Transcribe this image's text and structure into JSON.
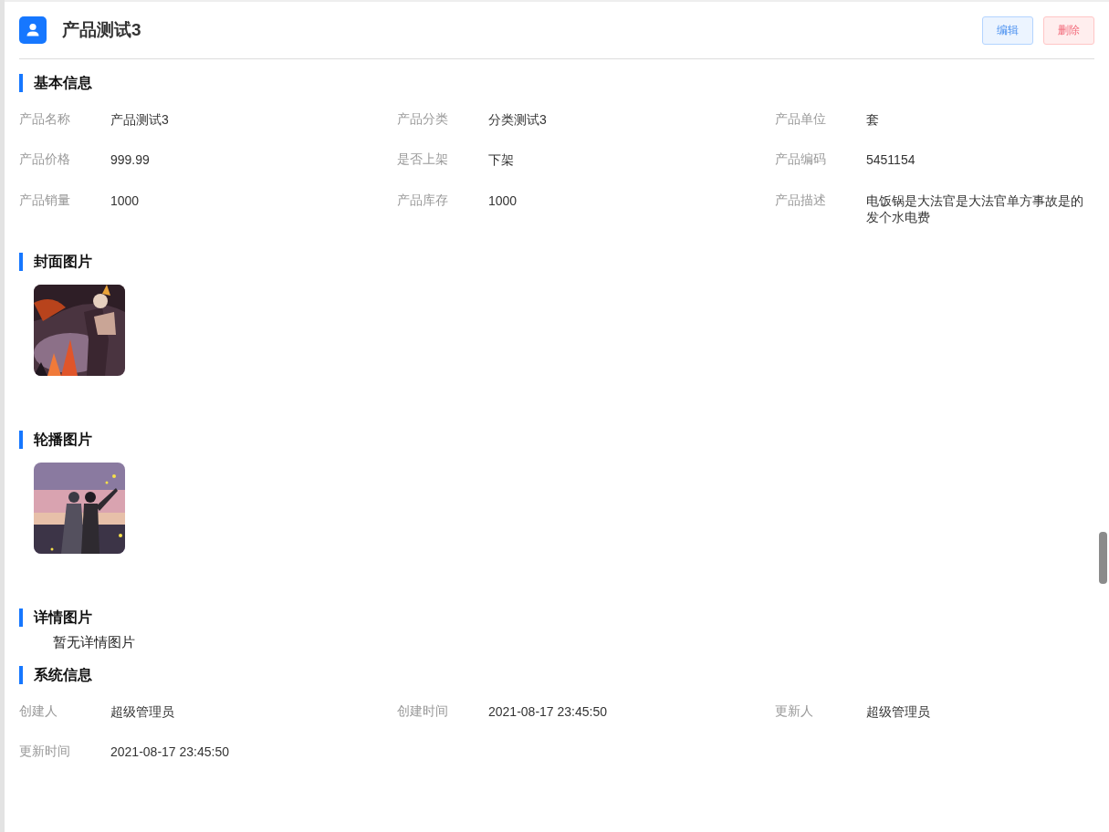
{
  "header": {
    "title": "产品测试3",
    "buttons": [
      {
        "label": "编辑",
        "kind": "primary"
      },
      {
        "label": "删除",
        "kind": "danger"
      }
    ]
  },
  "sections": [
    {
      "title": "基本信息",
      "kind": "fields",
      "fields": [
        {
          "label": "产品名称",
          "value": "产品测试3"
        },
        {
          "label": "产品分类",
          "value": "分类测试3"
        },
        {
          "label": "产品单位",
          "value": "套"
        },
        {
          "label": "产品价格",
          "value": "999.99"
        },
        {
          "label": "是否上架",
          "value": "下架"
        },
        {
          "label": "产品编码",
          "value": "5451154"
        },
        {
          "label": "产品销量",
          "value": "1000"
        },
        {
          "label": "产品库存",
          "value": "1000"
        },
        {
          "label": "产品描述",
          "value": "电饭锅是大法官是大法官单方事故是的发个水电费"
        }
      ]
    },
    {
      "title": "封面图片",
      "kind": "images"
    },
    {
      "title": "轮播图片",
      "kind": "images"
    },
    {
      "title": "详情图片",
      "kind": "empty",
      "text": "暂无详情图片"
    },
    {
      "title": "系统信息",
      "kind": "fields",
      "fields": [
        {
          "label": "创建人",
          "value": "超级管理员"
        },
        {
          "label": "创建时间",
          "value": "2021-08-17 23:45:50"
        },
        {
          "label": "更新人",
          "value": "超级管理员"
        },
        {
          "label": "更新时间",
          "value": "2021-08-17 23:45:50"
        }
      ]
    }
  ]
}
